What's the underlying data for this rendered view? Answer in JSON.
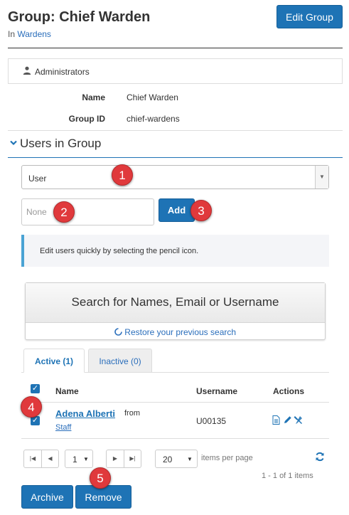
{
  "header": {
    "title": "Group: Chief Warden",
    "breadcrumb_prefix": "In",
    "breadcrumb_link": "Wardens",
    "edit_button": "Edit Group"
  },
  "admin_panel": {
    "label": "Administrators",
    "icon": "user-icon"
  },
  "details": {
    "name_label": "Name",
    "name_value": "Chief Warden",
    "group_id_label": "Group ID",
    "group_id_value": "chief-wardens"
  },
  "users_section": {
    "title": "Users in Group",
    "type_select_value": "User",
    "input_placeholder": "None",
    "add_button": "Add",
    "info_text": "Edit users quickly by selecting the pencil icon.",
    "search_title": "Search for Names, Email or Username",
    "restore_link": "Restore your previous search"
  },
  "tabs": [
    {
      "label": "Active (1)",
      "active": true
    },
    {
      "label": "Inactive (0)",
      "active": false
    }
  ],
  "table": {
    "headers": {
      "name": "Name",
      "username": "Username",
      "actions": "Actions"
    },
    "rows": [
      {
        "name": "Adena Alberti",
        "from": "from",
        "dept": "Staff",
        "username": "U00135"
      }
    ]
  },
  "pagination": {
    "page": "1",
    "per_page": "20",
    "per_page_label": "items per page",
    "count_text": "1 - 1 of 1 items"
  },
  "footer_buttons": {
    "archive": "Archive",
    "remove": "Remove"
  },
  "badges": [
    "1",
    "2",
    "3",
    "4",
    "5"
  ],
  "colors": {
    "primary": "#1e73b5",
    "badge": "#e0393c",
    "info_accent": "#4aa3d4"
  }
}
